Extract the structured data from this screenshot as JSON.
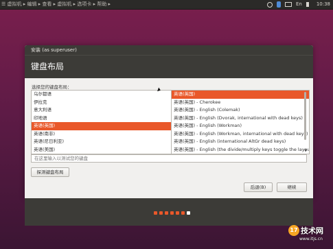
{
  "topbar": {
    "title": "☰ 虚拟机 ▸ 编辑 ▸ 查看 ▸ 虚拟机 ▸ 选项卡 ▸ 帮助 ▸",
    "tray": [
      "En",
      "10:38"
    ]
  },
  "window": {
    "title": "安装 (as superuser)",
    "heading": "键盘布局"
  },
  "layout_prompt": "选择您的键盘布局：",
  "left_list": {
    "items": [
      "乌尔都语",
      "伊拉克",
      "意大利语",
      "印地语",
      "英语(英国)",
      "英语(南非)",
      "英语(尼日利亚)",
      "英语(美国)",
      "越南语"
    ],
    "selected_index": 4
  },
  "right_list": {
    "items": [
      "英语(英国)",
      "英语(英国) - Cherokee",
      "英语(英国) - English (Colemak)",
      "英语(英国) - English (Dvorak, international with dead keys)",
      "英语(英国) - English (Workman)",
      "英语(英国) - English (Workman, international with dead keys)",
      "英语(英国) - English (international AltGr dead keys)",
      "英语(英国) - English (the divide/multiply keys toggle the layout)"
    ],
    "selected_index": 0
  },
  "test_input": {
    "placeholder": "在这里输入以测试您的键盘"
  },
  "buttons": {
    "detect": "探测键盘布局",
    "back": "后退(B)",
    "continue": "继续"
  },
  "progress": {
    "total_steps": 7,
    "current_step": 7
  },
  "watermark": {
    "badge": "17",
    "text": "技术网",
    "url": "www.itjs.cn"
  },
  "colors": {
    "accent": "#e9582a",
    "panel": "#3c3b37"
  }
}
